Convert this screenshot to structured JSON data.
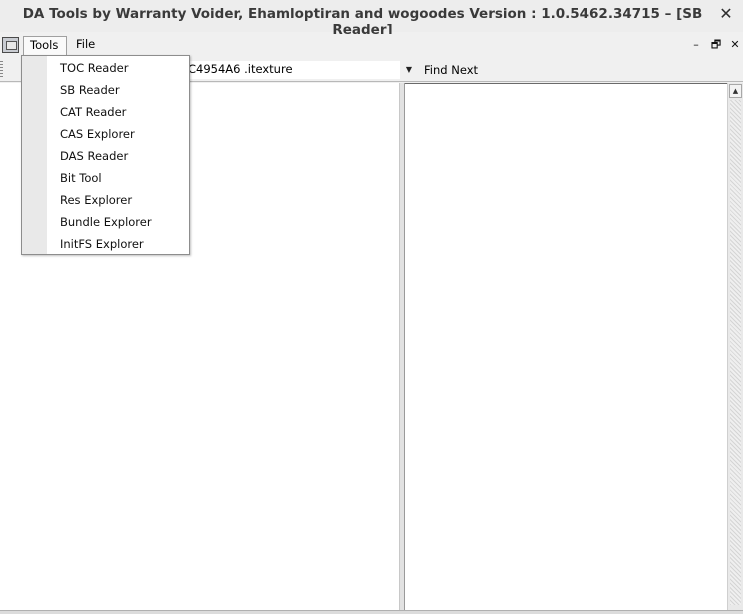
{
  "window": {
    "title": "DA Tools by Warranty Voider, Ehamloptiran and wogoodes Version : 1.0.5462.34715 – [SB Reader]",
    "close_glyph": "✕"
  },
  "menubar": {
    "tools_label": "Tools",
    "file_label": "File",
    "minimize_glyph": "–",
    "restore_glyph": "🗗",
    "close_glyph": "✕"
  },
  "toolbar": {
    "path_value": "C4954A6 .itexture",
    "dropdown_glyph": "▼",
    "find_next_label": "Find Next"
  },
  "tools_menu": {
    "items": [
      {
        "label": "TOC Reader"
      },
      {
        "label": "SB Reader"
      },
      {
        "label": "CAT Reader"
      },
      {
        "label": "CAS Explorer"
      },
      {
        "label": "DAS Reader"
      },
      {
        "label": "Bit Tool"
      },
      {
        "label": "Res Explorer"
      },
      {
        "label": "Bundle Explorer"
      },
      {
        "label": "InitFS Explorer"
      }
    ]
  },
  "scrollbar": {
    "up_glyph": "▲"
  }
}
